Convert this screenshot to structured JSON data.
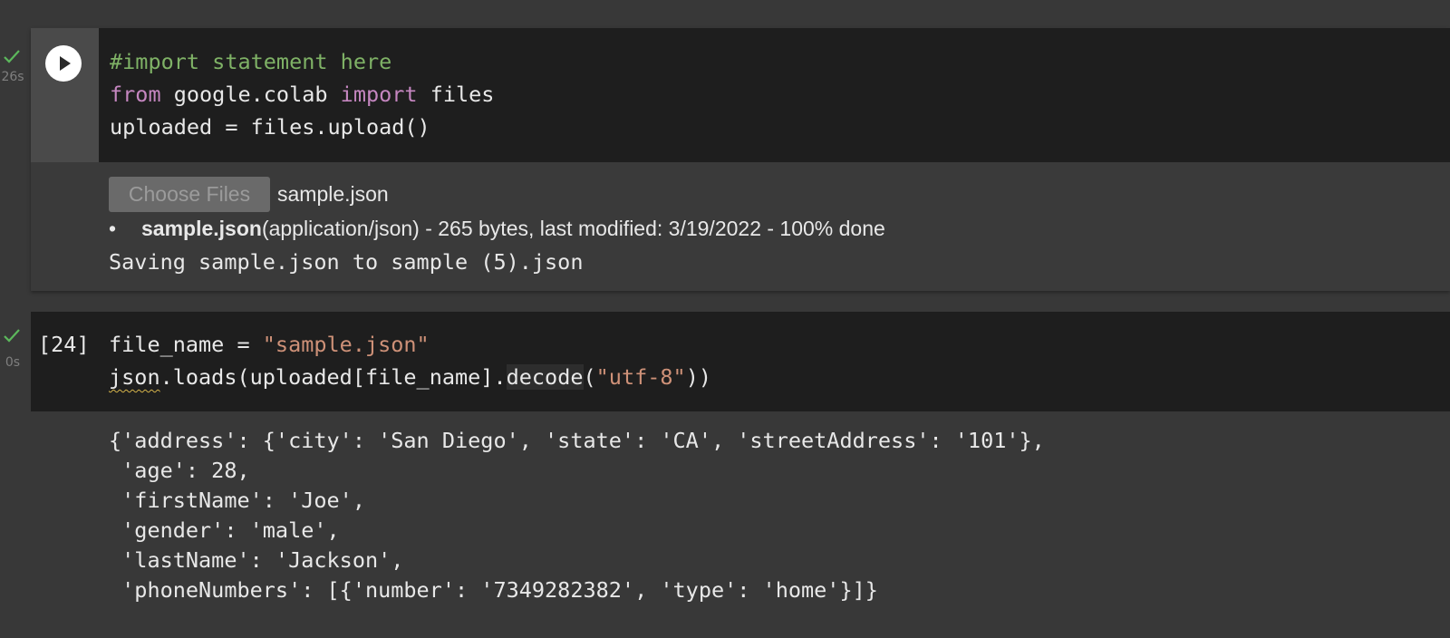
{
  "cells": [
    {
      "status_icon": "check-icon",
      "status_color": "#5cb85c",
      "time": "26s",
      "code_lines": [
        [
          {
            "t": "#import statement here",
            "k": "comment"
          }
        ],
        [
          {
            "t": "from",
            "k": "keyword"
          },
          {
            "t": " google.colab ",
            "k": "plain"
          },
          {
            "t": "import",
            "k": "keyword"
          },
          {
            "t": " files",
            "k": "plain"
          }
        ],
        [
          {
            "t": "uploaded = files.upload()",
            "k": "plain"
          }
        ]
      ],
      "output": {
        "choose_button_label": "Choose Files",
        "chosen_file": "sample.json",
        "upload_name": "sample.json",
        "upload_detail": "(application/json) - 265 bytes, last modified: 3/19/2022 - 100% done",
        "saving_text": "Saving sample.json to sample (5).json"
      }
    },
    {
      "status_icon": "check-icon",
      "status_color": "#5cb85c",
      "time": "0s",
      "execution_count": "[24]",
      "code_lines": [
        [
          {
            "t": "file_name = ",
            "k": "plain"
          },
          {
            "t": "\"sample.json\"",
            "k": "string"
          }
        ],
        [
          {
            "t": "json",
            "k": "plain",
            "squiggle": true
          },
          {
            "t": ".loads(uploaded[file_name].",
            "k": "plain"
          },
          {
            "t": "decode",
            "k": "plain",
            "hl": true
          },
          {
            "t": "(",
            "k": "plain"
          },
          {
            "t": "\"utf-8\"",
            "k": "string"
          },
          {
            "t": "))",
            "k": "plain"
          }
        ]
      ],
      "output_lines": [
        "{'address': {'city': 'San Diego', 'state': 'CA', 'streetAddress': '101'},",
        " 'age': 28,",
        " 'firstName': 'Joe',",
        " 'gender': 'male',",
        " 'lastName': 'Jackson',",
        " 'phoneNumbers': [{'number': '7349282382', 'type': 'home'}]}"
      ]
    }
  ]
}
